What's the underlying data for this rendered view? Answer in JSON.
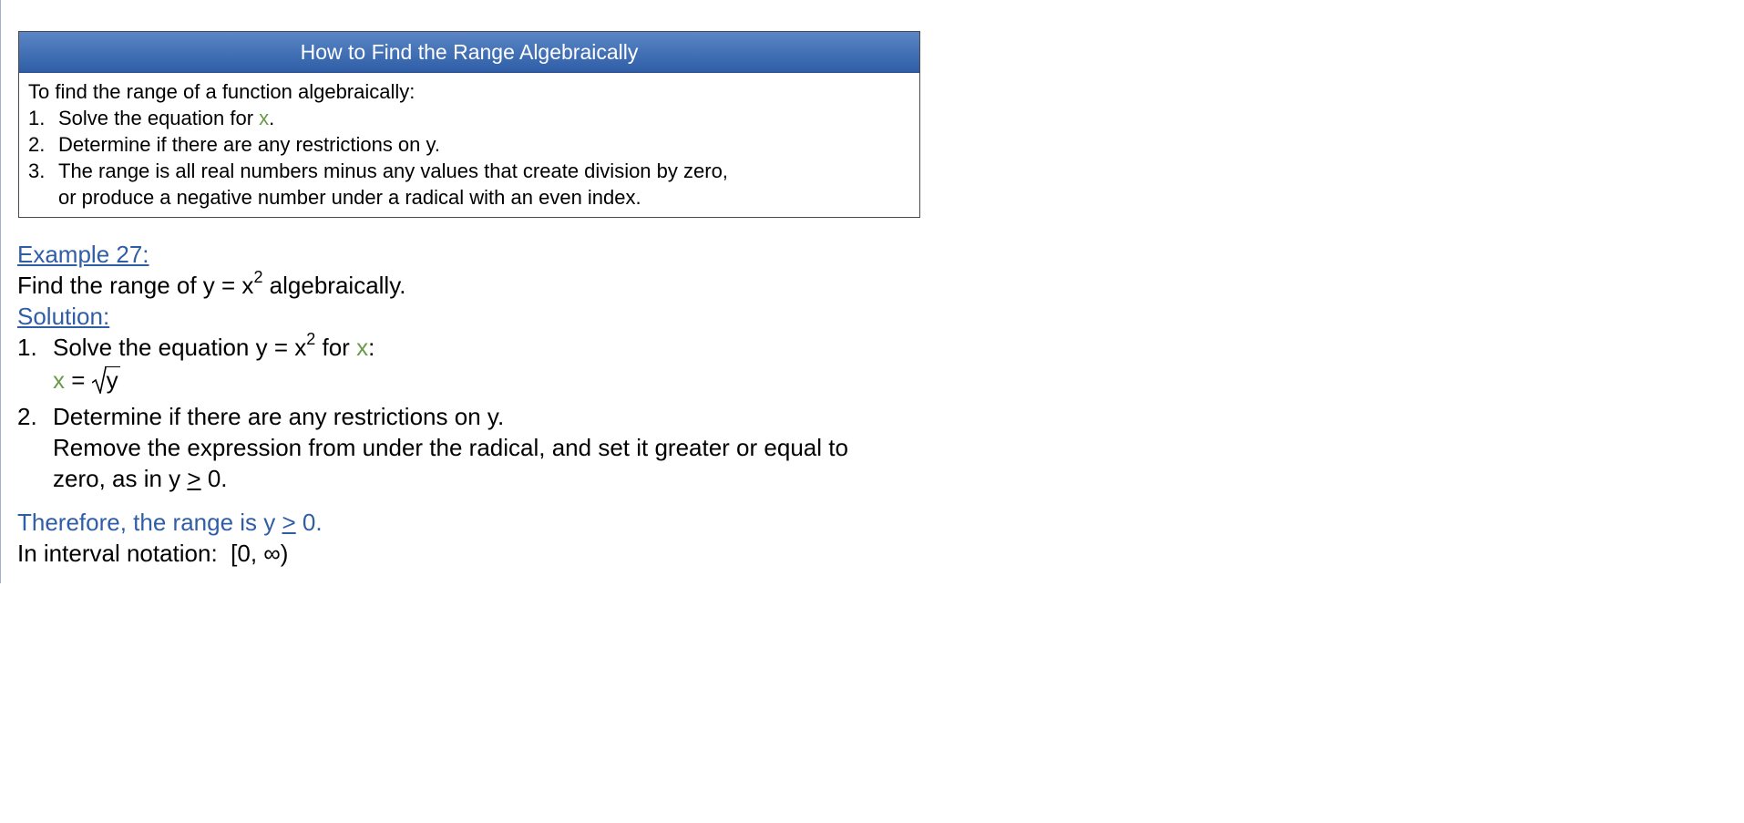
{
  "box": {
    "title": "How to Find the Range Algebraically",
    "intro": "To find the range of a function algebraically:",
    "steps": [
      {
        "num": "1.",
        "pre": "Solve the equation for ",
        "var": "x",
        "post": "."
      },
      {
        "num": "2.",
        "text": "Determine if there are any restrictions on y."
      },
      {
        "num": "3.",
        "line1": "The range is all real numbers minus any values that create division by zero,",
        "line2": "or produce a negative number under a radical with an even index."
      }
    ]
  },
  "example": {
    "heading": "Example 27:",
    "problem_pre": "Find the range of y = x",
    "problem_exp": "2",
    "problem_post": " algebraically.",
    "solution_label": "Solution:",
    "step1": {
      "num": "1.",
      "pre": "Solve the equation y = x",
      "exp": "2",
      "mid": " for ",
      "var": "x",
      "post": ":",
      "eq_var": "x",
      "eq_op": " = ",
      "radicand": "y"
    },
    "step2": {
      "num": "2.",
      "line1": "Determine if there are any restrictions on y.",
      "line2": "Remove the expression from under the radical, and set it greater or equal to",
      "line3_pre": "zero, as in y ",
      "line3_sym": ">",
      "line3_post": " 0."
    },
    "conclusion_pre": "Therefore, the range is y ",
    "conclusion_sym": ">",
    "conclusion_post": " 0.",
    "interval_label": "In interval notation:  ",
    "interval_value": "[0, ∞)"
  },
  "colors": {
    "header_bg": "#2f5ea7",
    "accent_blue": "#2f5ea7",
    "variable_green": "#6a9a4a"
  }
}
